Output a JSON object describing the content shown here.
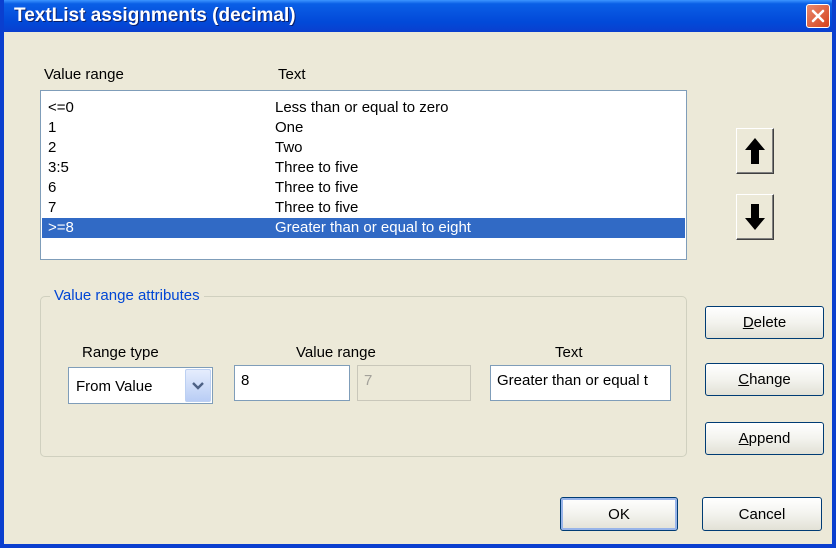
{
  "window": {
    "title": "TextList assignments (decimal)"
  },
  "list": {
    "headers": {
      "range": "Value range",
      "text": "Text"
    },
    "rows": [
      {
        "range": "<=0",
        "text": "Less than or equal to zero"
      },
      {
        "range": "1",
        "text": "One"
      },
      {
        "range": "2",
        "text": "Two"
      },
      {
        "range": "3:5",
        "text": "Three to five"
      },
      {
        "range": "6",
        "text": "Three to five"
      },
      {
        "range": "7",
        "text": "Three to five"
      },
      {
        "range": ">=8",
        "text": "Greater than or equal to eight"
      }
    ],
    "selected_index": 6
  },
  "group": {
    "caption": "Value range attributes",
    "range_type_label": "Range type",
    "value_range_label": "Value range",
    "text_label": "Text",
    "range_type_value": "From Value",
    "value_from": "8",
    "value_to": "7",
    "text_value": "Greater than or equal t"
  },
  "buttons": {
    "delete_accel": "D",
    "delete_rest": "elete",
    "change_accel": "C",
    "change_rest": "hange",
    "append_accel": "A",
    "append_rest": "ppend",
    "ok": "OK",
    "cancel": "Cancel"
  },
  "icons": {
    "close": "close-icon",
    "up": "arrow-up-icon",
    "down": "arrow-down-icon",
    "dropdown": "chevron-down-icon"
  },
  "colors": {
    "title_bar": "#0a5fe6",
    "selection": "#316ac5",
    "group_caption": "#0046d5",
    "close_button": "#d5421d",
    "dialog_face": "#ece9d8"
  }
}
